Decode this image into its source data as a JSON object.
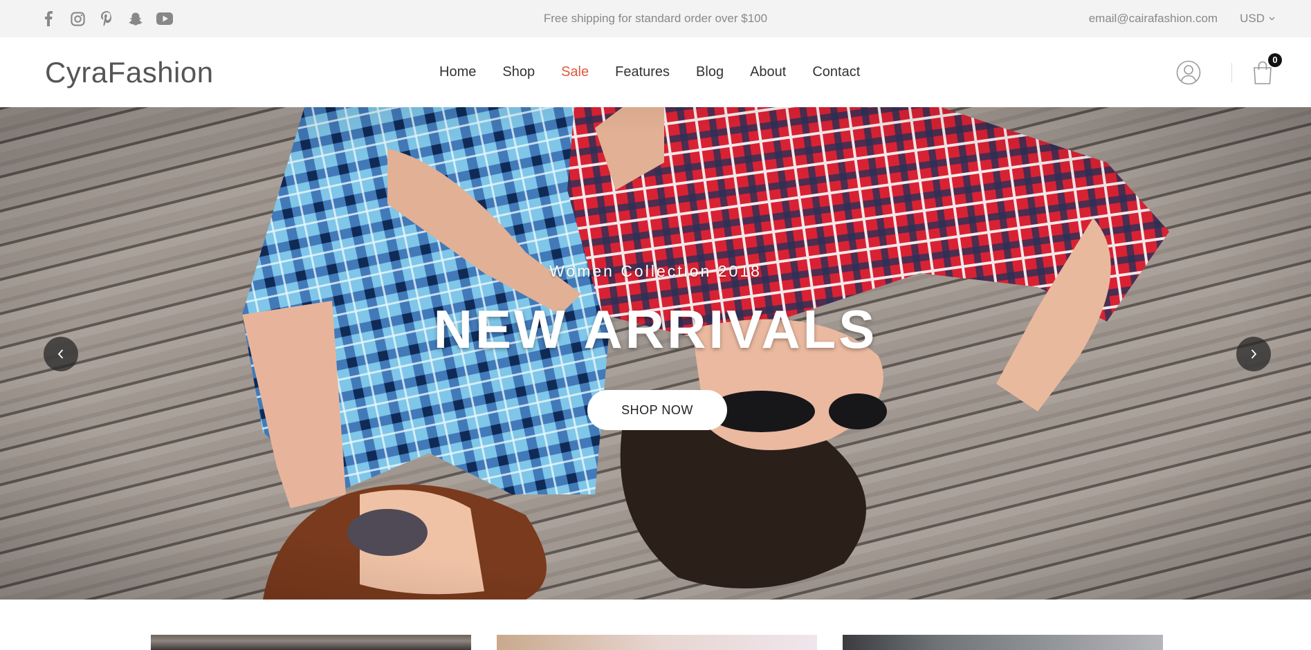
{
  "topbar": {
    "social_icons": [
      "facebook-icon",
      "instagram-icon",
      "pinterest-icon",
      "snapchat-icon",
      "youtube-icon"
    ],
    "shipping_text": "Free shipping for standard order over $100",
    "email": "email@cairafashion.com",
    "currency": "USD"
  },
  "header": {
    "logo": "CyraFashion",
    "nav": [
      {
        "label": "Home"
      },
      {
        "label": "Shop"
      },
      {
        "label": "Sale",
        "color": "#e2583e"
      },
      {
        "label": "Features"
      },
      {
        "label": "Blog"
      },
      {
        "label": "About"
      },
      {
        "label": "Contact"
      }
    ],
    "cart_count": "0"
  },
  "hero": {
    "subtitle": "Women Collection 2018",
    "title": "NEW ARRIVALS",
    "button": "SHOP NOW"
  },
  "colors": {
    "accent": "#e2583e",
    "topbar_bg": "#f3f3f3",
    "text_muted": "#888888"
  }
}
